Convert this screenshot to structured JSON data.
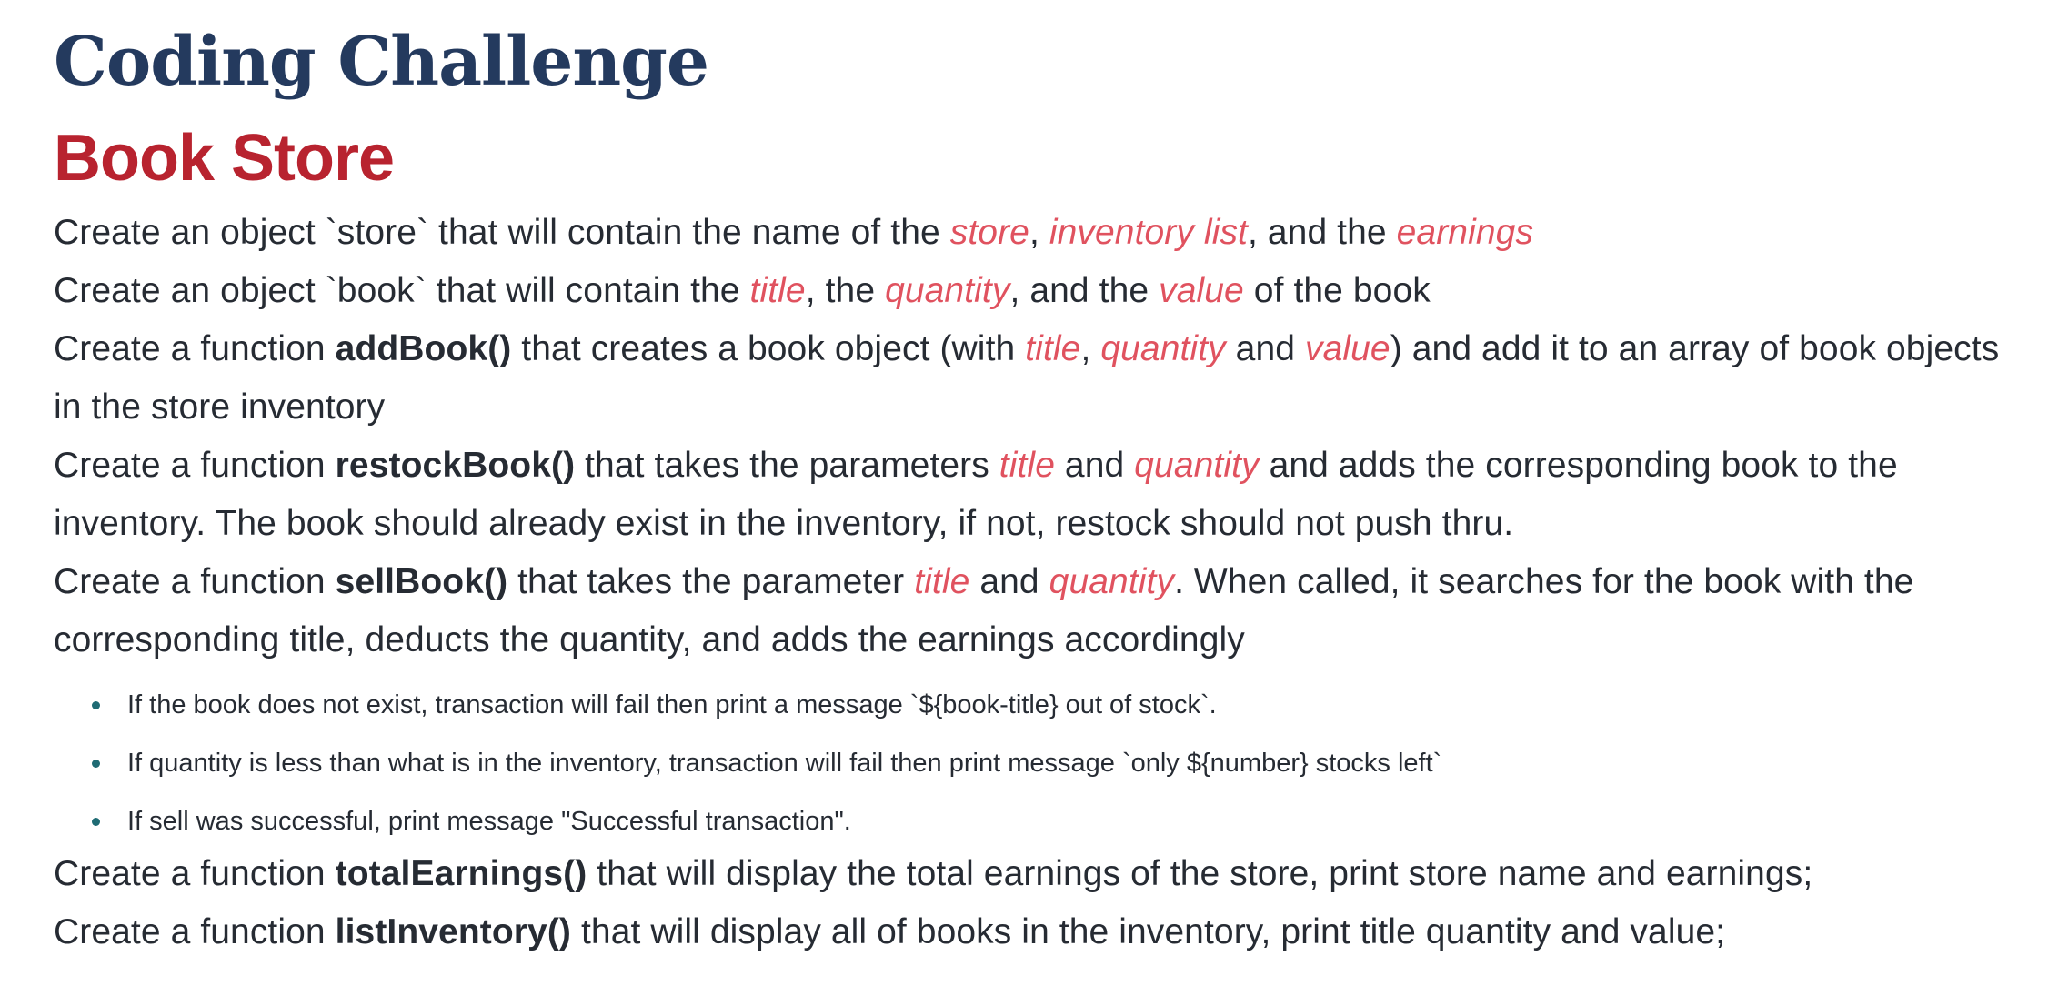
{
  "heading": {
    "title": "Coding Challenge",
    "subtitle": "Book Store"
  },
  "intro_items": [
    {
      "prefix": "Create an object `store` that will contain the name of the ",
      "hl1": "store",
      "sep1": ", ",
      "hl2": "inventory list",
      "sep2": ", and the ",
      "hl3": "earnings"
    },
    {
      "prefix": "Create an object `book` that will contain the ",
      "hl1": "title",
      "sep1": ", the ",
      "hl2": "quantity",
      "sep2": ", and the ",
      "hl3": "value",
      "suffix": " of the book"
    }
  ],
  "functions": [
    {
      "lead": "Create a function ",
      "name": "addBook()",
      "text1": " that creates a book object (with ",
      "hl1": "title",
      "text2": ", ",
      "hl2": "quantity",
      "text3": " and ",
      "hl3": "value",
      "text4": ") and add it to an array of book objects in the store inventory"
    },
    {
      "lead": "Create a function ",
      "name": "restockBook()",
      "text1": " that takes the parameters ",
      "hl1": "title",
      "text2": " and ",
      "hl2": "quantity",
      "text3": " and adds the corresponding book to the inventory. The book should already exist in the inventory, if not, restock should not push thru."
    },
    {
      "lead": "Create a function ",
      "name": "sellBook()",
      "text1": " that takes the parameter ",
      "hl1": "title",
      "text2": " and ",
      "hl2": "quantity",
      "text3": ". When called, it searches for the book with the corresponding title, deducts the quantity, and adds the earnings accordingly"
    },
    {
      "lead": "Create a function ",
      "name": "totalEarnings()",
      "text1": " that will display the total earnings of the store, print store name and earnings;"
    },
    {
      "lead": "Create a function ",
      "name": "listInventory()",
      "text1": " that will display all of books in the inventory, print title quantity and value;"
    }
  ],
  "sell_rules": [
    "If the book does not exist, transaction will fail then print a message `${book-title} out of stock`.",
    "If quantity is less than what is in the inventory, transaction will fail then print message `only ${number} stocks left`",
    "If sell was successful, print message \"Successful transaction\"."
  ]
}
